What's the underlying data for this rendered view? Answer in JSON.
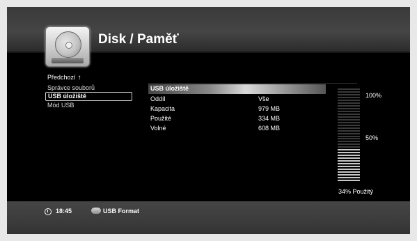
{
  "header": {
    "title": "Disk / Paměť"
  },
  "nav": {
    "back_label": "Předchozí",
    "back_arrow": "🠕"
  },
  "menu": {
    "items": [
      {
        "label": "Správce souborů"
      },
      {
        "label": "USB úložiště",
        "selected": true
      },
      {
        "label": "Mód USB"
      }
    ]
  },
  "info": {
    "header": "USB úložiště",
    "rows": [
      {
        "key": "Oddíl",
        "value": "Vše"
      },
      {
        "key": "Kapacita",
        "value": "979 MB"
      },
      {
        "key": "Použité",
        "value": "334 MB"
      },
      {
        "key": "Volné",
        "value": "608 MB"
      }
    ]
  },
  "gauge": {
    "label_top": "100%",
    "label_mid": "50%",
    "used_label": "34% Použitý",
    "used_fraction": 0.34,
    "fill_color": "#c8c8c8",
    "empty_color": "#3a3a3a"
  },
  "footer": {
    "time": "18:45",
    "usb_format_label": "USB Format"
  }
}
